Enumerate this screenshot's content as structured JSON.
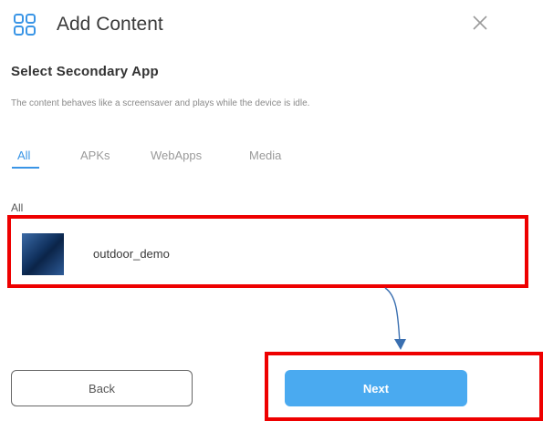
{
  "header": {
    "title": "Add Content",
    "app_icon": "grid-icon",
    "close_icon": "close-icon"
  },
  "section": {
    "title": "Select Secondary App",
    "description": "The content behaves like a screensaver and plays while the device is idle."
  },
  "tabs": [
    {
      "label": "All",
      "active": true
    },
    {
      "label": "APKs",
      "active": false
    },
    {
      "label": "WebApps",
      "active": false
    },
    {
      "label": "Media",
      "active": false
    }
  ],
  "group": {
    "label": "All",
    "items": [
      {
        "name": "outdoor_demo",
        "thumbnail_icon": "app-thumbnail-icon"
      }
    ]
  },
  "footer": {
    "back_label": "Back",
    "next_label": "Next"
  },
  "colors": {
    "accent": "#3a95e6",
    "next_button": "#4aaaf0",
    "highlight": "#ee0000",
    "annotation_arrow": "#3a6fb0"
  }
}
